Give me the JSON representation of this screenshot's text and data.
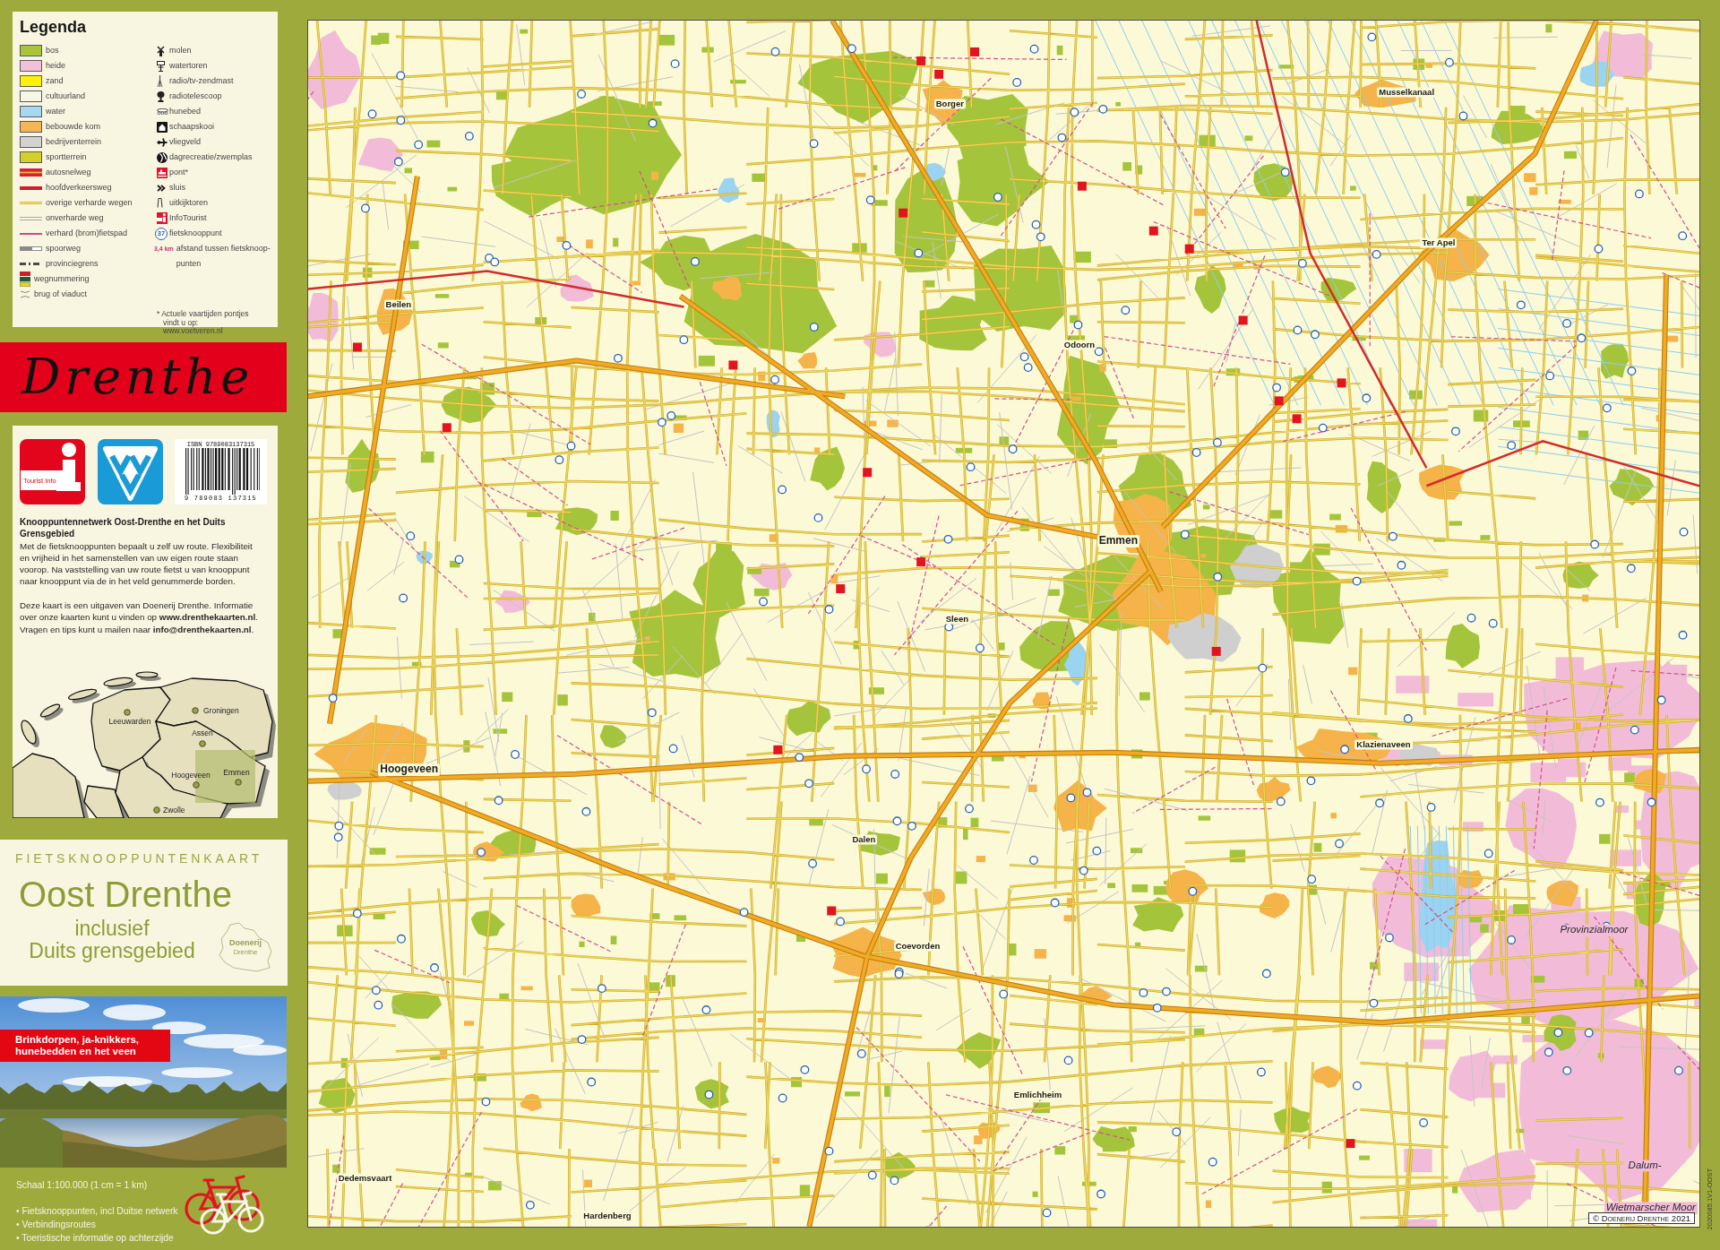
{
  "legend": {
    "title": "Legenda",
    "left_column": [
      {
        "label": "bos",
        "kind": "area",
        "color": "#a7c43b"
      },
      {
        "label": "heide",
        "kind": "area",
        "color": "#f3c0dc"
      },
      {
        "label": "zand",
        "kind": "area",
        "color": "#fff200"
      },
      {
        "label": "cultuurland",
        "kind": "area",
        "color": "#f6f6e2"
      },
      {
        "label": "water",
        "kind": "area",
        "color": "#a5d8f2"
      },
      {
        "label": "bebouwde kom",
        "kind": "area",
        "color": "#f7b55a"
      },
      {
        "label": "bedrijventerrein",
        "kind": "area",
        "color": "#d3d3d3"
      },
      {
        "label": "sportterrein",
        "kind": "area",
        "color": "#d4cf2a"
      },
      {
        "label": "autosnelweg",
        "kind": "motorway"
      },
      {
        "label": "hoofdverkeersweg",
        "kind": "main-road"
      },
      {
        "label": "overige verharde wegen",
        "kind": "road"
      },
      {
        "label": "onverharde weg",
        "kind": "unpaved"
      },
      {
        "label": "verhard (brom)fietspad",
        "kind": "cycle-path"
      },
      {
        "label": "spoorweg",
        "kind": "railway"
      },
      {
        "label": "provinciegrens",
        "kind": "border"
      },
      {
        "label": "wegnummering",
        "kind": "road-number"
      },
      {
        "label": "brug of viaduct",
        "kind": "bridge"
      }
    ],
    "right_column": [
      {
        "label": "molen",
        "kind": "windmill"
      },
      {
        "label": "watertoren",
        "kind": "water-tower"
      },
      {
        "label": "radio/tv-zendmast",
        "kind": "mast"
      },
      {
        "label": "radiotelescoop",
        "kind": "telescope"
      },
      {
        "label": "hunebed",
        "kind": "dolmen"
      },
      {
        "label": "schaapskooi",
        "kind": "sheepfold"
      },
      {
        "label": "vliegveld",
        "kind": "airfield"
      },
      {
        "label": "dagrecreatie/zwemplas",
        "kind": "recreation"
      },
      {
        "label": "pont*",
        "kind": "ferry"
      },
      {
        "label": "sluis",
        "kind": "lock"
      },
      {
        "label": "uitkijktoren",
        "kind": "lookout"
      },
      {
        "label": "InfoTourist",
        "kind": "info"
      },
      {
        "label": "fietsknooppunt",
        "kind": "node",
        "symbol": "37"
      },
      {
        "label": "afstand tussen fietsknoop-\npunten",
        "kind": "distance",
        "symbol": "3,4 km"
      }
    ],
    "footnote": "* Actuele vaartijden pontjes\nvindt u op:\nwww.voetveren.nl"
  },
  "banner": {
    "title": "Drenthe"
  },
  "info": {
    "logos": [
      {
        "kind": "tourist-info",
        "caption": "Tourist Info"
      },
      {
        "kind": "vvv"
      }
    ],
    "barcode": {
      "isbn": "ISBN 9789083137315",
      "digits": "9 789083 137315"
    },
    "heading": "Knooppuntennetwerk Oost-Drenthe en het Duits Grensgebied",
    "paragraphs": [
      "Met de fietsknooppunten bepaalt u zelf uw route. Flexibiliteit en vrijheid in het samenstellen van uw eigen route staan voorop. Na vaststelling van uw route fietst u van knooppunt naar knooppunt via de in het veld genummerde borden.",
      "Deze kaart is een uitgaven van Doenerij Drenthe. Informatie over onze kaarten kunt u vinden op **www.drenthekaarten.nl**. Vragen en tips kunt u mailen naar **info@drenthekaarten.nl**."
    ],
    "inset_map": {
      "cities": [
        {
          "name": "Groningen"
        },
        {
          "name": "Leeuwarden"
        },
        {
          "name": "Assen"
        },
        {
          "name": "Emmen"
        },
        {
          "name": "Hoogeveen"
        },
        {
          "name": "Zwolle"
        }
      ]
    }
  },
  "title_block": {
    "series": "FIETSKNOOPPUNTENKAART",
    "title": "Oost Drenthe",
    "subtitle": "inclusief\nDuits grensgebied",
    "publisher_logo": {
      "name": "Doenerij",
      "region": "Drenthe"
    }
  },
  "photo": {
    "caption": "Brinkdorpen, ja-knikkers,\nhunebedden en het veen"
  },
  "footer": {
    "scale": "Schaal 1:100.000 (1 cm = 1 km)",
    "features": [
      "• Fietsknooppunten, incl Duitse netwerk",
      "• Verbindingsroutes",
      "• Toeristische informatie op achterzijde"
    ]
  },
  "map": {
    "place_labels": [
      {
        "text": "Borger",
        "kind": "village"
      },
      {
        "text": "Musselkanaal",
        "kind": "village"
      },
      {
        "text": "Ter Apel",
        "kind": "village"
      },
      {
        "text": "Beilen",
        "kind": "village"
      },
      {
        "text": "Odoorn",
        "kind": "village"
      },
      {
        "text": "Emmen",
        "kind": "town"
      },
      {
        "text": "Sleen",
        "kind": "village"
      },
      {
        "text": "Klazienaveen",
        "kind": "village"
      },
      {
        "text": "Hoogeveen",
        "kind": "town"
      },
      {
        "text": "Dalen",
        "kind": "village"
      },
      {
        "text": "Provinzialmoor",
        "kind": "region"
      },
      {
        "text": "Coevorden",
        "kind": "village"
      },
      {
        "text": "Emlichheim",
        "kind": "village"
      },
      {
        "text": "Dalum-",
        "kind": "region"
      },
      {
        "text": "Dedemsvaart",
        "kind": "village"
      },
      {
        "text": "Wietmarscher Moor",
        "kind": "region"
      },
      {
        "text": "Hardenberg",
        "kind": "village"
      }
    ],
    "copyright": "© Doenerij Drenthe 2021",
    "edition_code": "2020085.1V1-OOST"
  }
}
